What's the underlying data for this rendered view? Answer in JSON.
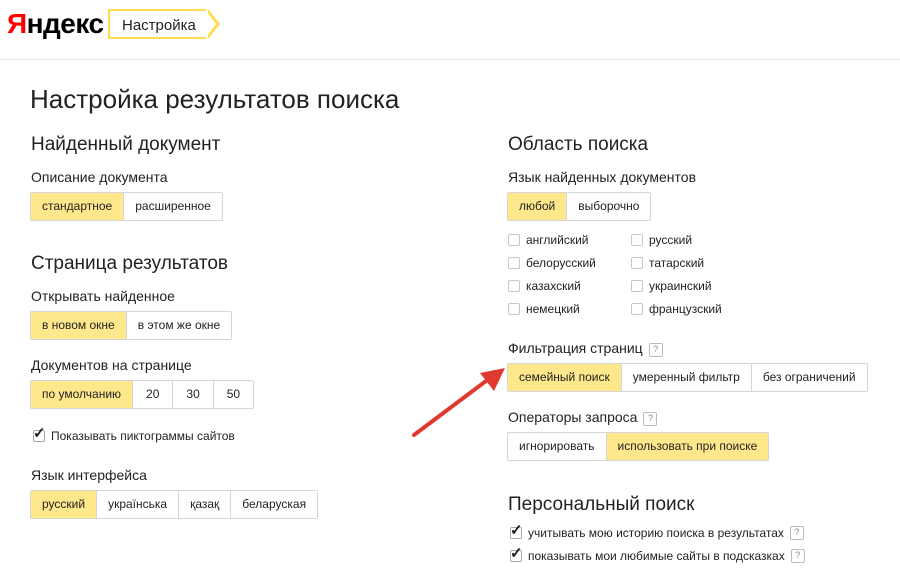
{
  "header": {
    "logo_first": "Я",
    "logo_rest": "ндекс",
    "breadcrumb": "Настройка"
  },
  "page_title": "Настройка результатов поиска",
  "found_document": {
    "title": "Найденный документ",
    "description_label": "Описание документа",
    "options": [
      "стандартное",
      "расширенное"
    ],
    "selected": 0
  },
  "results_page": {
    "title": "Страница результатов",
    "open_label": "Открывать найденное",
    "open_options": [
      "в новом окне",
      "в этом же окне"
    ],
    "open_selected": 0,
    "docs_label": "Документов на странице",
    "docs_options": [
      "по умолчанию",
      "20",
      "30",
      "50"
    ],
    "docs_selected": 0,
    "favicons_label": "Показывать пиктограммы сайтов",
    "favicons_checked": true,
    "ui_lang_label": "Язык интерфейса",
    "ui_lang_options": [
      "русский",
      "українська",
      "қазақ",
      "беларуская"
    ],
    "ui_lang_selected": 0
  },
  "search_area": {
    "title": "Область поиска",
    "lang_label": "Язык найденных документов",
    "lang_options": [
      "любой",
      "выборочно"
    ],
    "lang_selected": 0,
    "languages_left": [
      "английский",
      "белорусский",
      "казахский",
      "немецкий"
    ],
    "languages_right": [
      "русский",
      "татарский",
      "украинский",
      "французский"
    ],
    "filter_label": "Фильтрация страниц",
    "filter_help": "?",
    "filter_options": [
      "семейный поиск",
      "умеренный фильтр",
      "без ограничений"
    ],
    "filter_selected": 0,
    "operators_label": "Операторы запроса",
    "operators_help": "?",
    "operators_options": [
      "игнорировать",
      "использовать при поиске"
    ],
    "operators_selected": 1
  },
  "personal": {
    "title": "Персональный поиск",
    "history_label": "учитывать мою историю поиска в результатах",
    "history_help": "?",
    "favorites_label": "показывать мои любимые сайты в подсказках",
    "favorites_help": "?"
  },
  "colors": {
    "accent": "#ffdb4d",
    "selected_bg": "#ffe88c",
    "logo_red": "#ff0000",
    "arrow": "#e03a2f"
  }
}
